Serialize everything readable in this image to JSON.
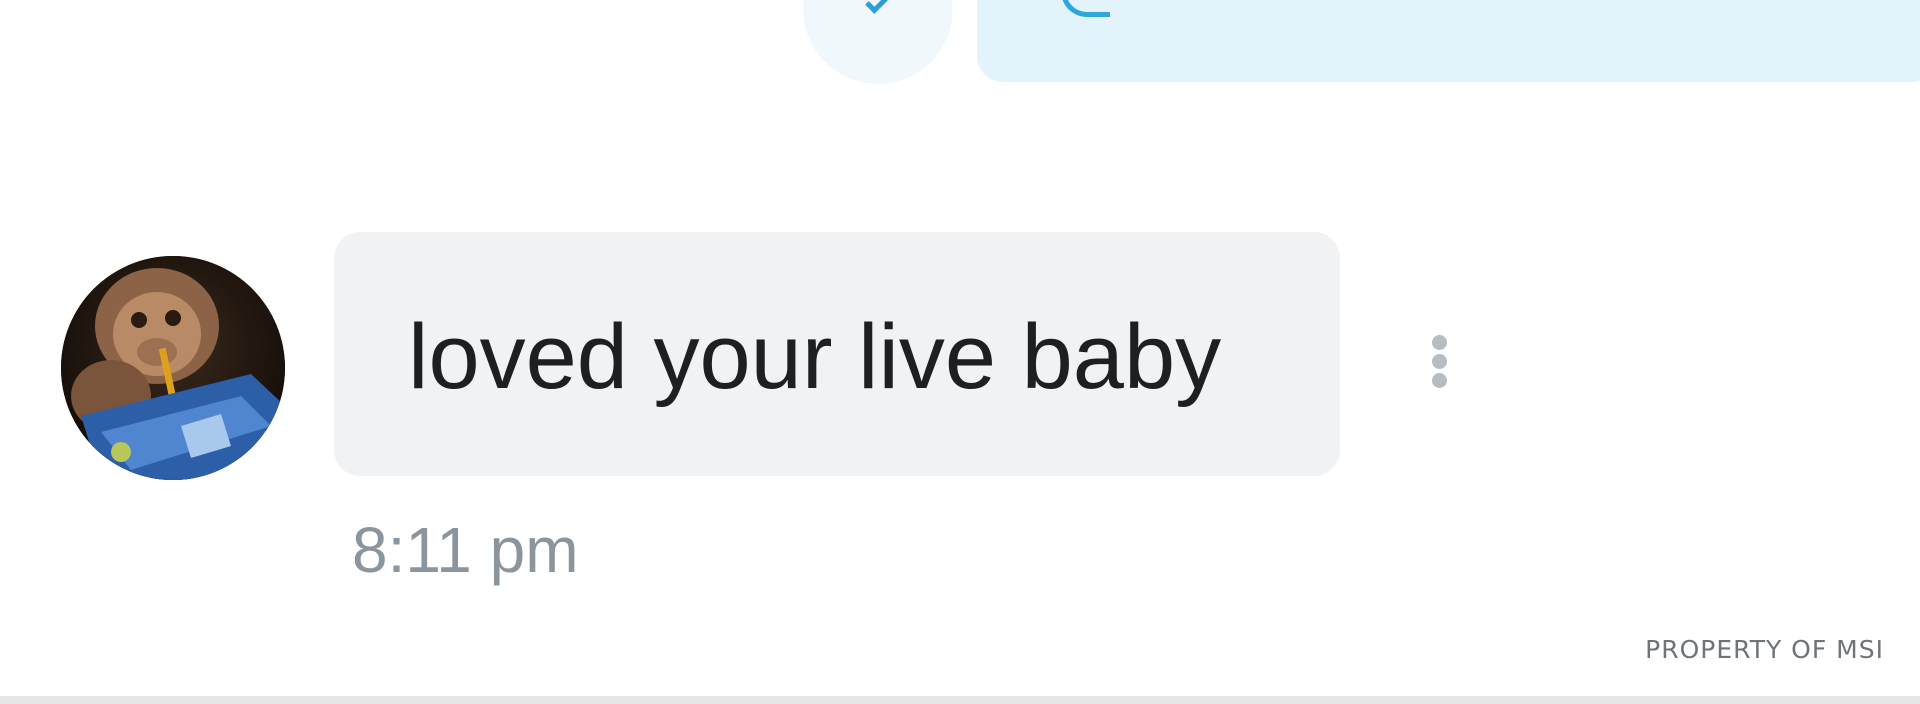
{
  "previous_message": {
    "avatar_icon": "check-icon",
    "bubble_color": "#e3f3fb"
  },
  "message": {
    "text": "loved your live baby",
    "time": "8:11 pm",
    "avatar_description": "monkey drinking from a blue juice pouch",
    "bubble_color": "#f0f2f3",
    "more_icon": "more-vertical-icon"
  },
  "watermark": "PROPERTY OF MSI"
}
